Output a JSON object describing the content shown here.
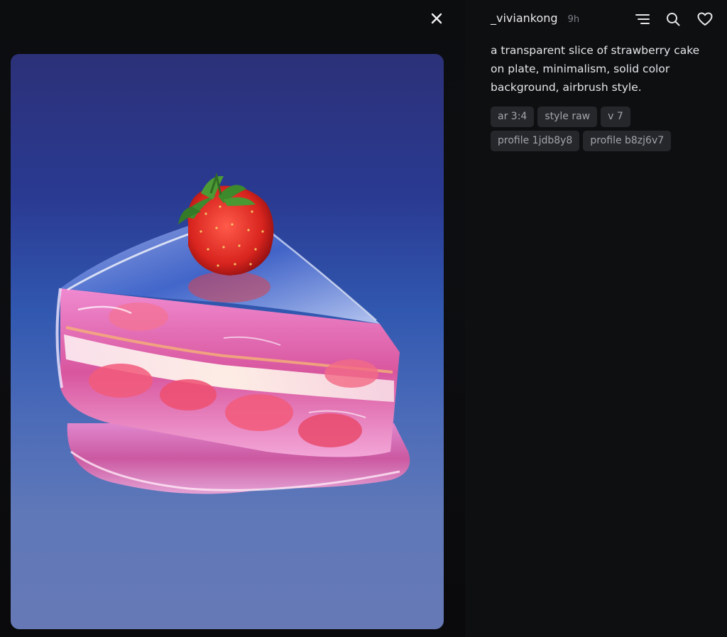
{
  "viewer": {
    "image_subject": "transparent strawberry cake slice"
  },
  "panel": {
    "username": "_viviankong",
    "time": "9h",
    "prompt": "a transparent slice of strawberry cake on plate, minimalism, solid color background, airbrush style.",
    "tags": [
      "ar 3:4",
      "style raw",
      "v 7",
      "profile 1jdb8y8",
      "profile b8zj6v7"
    ]
  },
  "icons": {
    "close": "close-icon",
    "menu": "menu-lines-icon",
    "search": "search-icon",
    "like": "heart-icon"
  },
  "colors": {
    "background": "#0b0b0c",
    "panel": "#0e0f11",
    "tag_bg": "#25272b",
    "text": "#e4e5e8",
    "muted": "#7d7f86"
  }
}
